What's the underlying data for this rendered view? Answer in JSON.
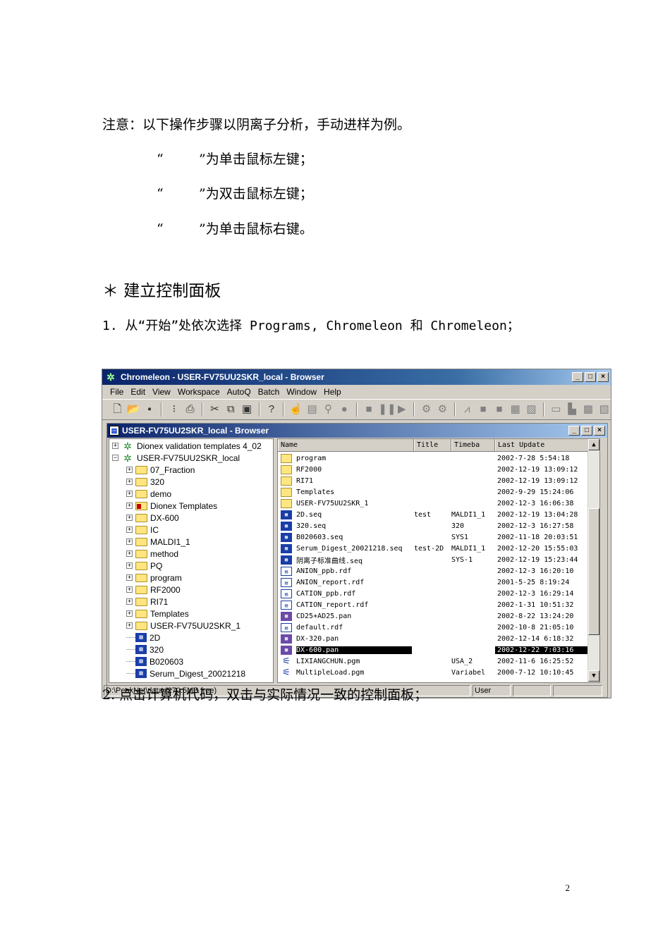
{
  "doc": {
    "note": "注意：以下操作步骤以阴离子分析，手动进样为例。",
    "mouse_lines": [
      {
        "open": "“",
        "close": "”为单击鼠标左键；"
      },
      {
        "open": "“",
        "close": "”为双击鼠标左键；"
      },
      {
        "open": "“",
        "close": "”为单击鼠标右键。"
      }
    ],
    "heading": "＊ 建立控制面板",
    "step1": "1. 从“开始”处依次选择 Programs, Chromeleon 和 Chromeleon；",
    "step2": "2. 点击计算机代码，双击与实际情况一致的控制面板；",
    "page_number": "2"
  },
  "window": {
    "title": "Chromeleon - USER-FV75UU2SKR_local - Browser",
    "menu": [
      "File",
      "Edit",
      "View",
      "Workspace",
      "AutoQ",
      "Batch",
      "Window",
      "Help"
    ],
    "toolbar_icons": [
      "new-icon",
      "open-icon",
      "save-icon",
      "print-icon",
      "cut-icon",
      "copy-icon",
      "paste-icon",
      "help-icon",
      "pointer-icon",
      "stop-icon",
      "pause-icon",
      "play-icon"
    ],
    "child_title": "USER-FV75UU2SKR_local - Browser",
    "tree": [
      {
        "label": "Dionex validation templates 4_02",
        "level": 0,
        "icon": "server-icon",
        "expander": "+"
      },
      {
        "label": "USER-FV75UU2SKR_local",
        "level": 0,
        "icon": "server-icon",
        "expander": "−"
      },
      {
        "label": "07_Fraction",
        "level": 1,
        "icon": "folder-icon",
        "expander": "+"
      },
      {
        "label": "320",
        "level": 1,
        "icon": "folder-icon",
        "expander": "+"
      },
      {
        "label": "demo",
        "level": 1,
        "icon": "folder-icon",
        "expander": "+"
      },
      {
        "label": "Dionex Templates",
        "level": 1,
        "icon": "locked-folder-icon",
        "expander": "+"
      },
      {
        "label": "DX-600",
        "level": 1,
        "icon": "folder-icon",
        "expander": "+"
      },
      {
        "label": "IC",
        "level": 1,
        "icon": "folder-icon",
        "expander": "+"
      },
      {
        "label": "MALDI1_1",
        "level": 1,
        "icon": "folder-icon",
        "expander": "+"
      },
      {
        "label": "method",
        "level": 1,
        "icon": "folder-icon",
        "expander": "+"
      },
      {
        "label": "PQ",
        "level": 1,
        "icon": "folder-icon",
        "expander": "+"
      },
      {
        "label": "program",
        "level": 1,
        "icon": "folder-icon",
        "expander": "+"
      },
      {
        "label": "RF2000",
        "level": 1,
        "icon": "folder-icon",
        "expander": "+"
      },
      {
        "label": "RI71",
        "level": 1,
        "icon": "folder-icon",
        "expander": "+"
      },
      {
        "label": "Templates",
        "level": 1,
        "icon": "folder-icon",
        "expander": "+"
      },
      {
        "label": "USER-FV75UU2SKR_1",
        "level": 1,
        "icon": "folder-icon",
        "expander": "+"
      },
      {
        "label": "2D",
        "level": 1,
        "icon": "sequence-icon",
        "expander": ""
      },
      {
        "label": "320",
        "level": 1,
        "icon": "sequence-icon",
        "expander": ""
      },
      {
        "label": "B020603",
        "level": 1,
        "icon": "sequence-icon",
        "expander": ""
      },
      {
        "label": "Serum_Digest_20021218",
        "level": 1,
        "icon": "sequence-icon",
        "expander": ""
      }
    ],
    "list_headers": [
      "Name",
      "Title",
      "Timeba",
      "Last Update"
    ],
    "files": [
      {
        "name": "program",
        "title": "",
        "timebase": "",
        "date": "2002-7-28 5:54:18",
        "icon": "folder"
      },
      {
        "name": "RF2000",
        "title": "",
        "timebase": "",
        "date": "2002-12-19 13:09:12",
        "icon": "folder"
      },
      {
        "name": "RI71",
        "title": "",
        "timebase": "",
        "date": "2002-12-19 13:09:12",
        "icon": "folder"
      },
      {
        "name": "Templates",
        "title": "",
        "timebase": "",
        "date": "2002-9-29 15:24:06",
        "icon": "folder"
      },
      {
        "name": "USER-FV75UU2SKR_1",
        "title": "",
        "timebase": "",
        "date": "2002-12-3 16:06:38",
        "icon": "folder"
      },
      {
        "name": "2D.seq",
        "title": "test",
        "timebase": "MALDI1_1",
        "date": "2002-12-19 13:04:28",
        "icon": "seq"
      },
      {
        "name": "320.seq",
        "title": "",
        "timebase": "320",
        "date": "2002-12-3 16:27:58",
        "icon": "seq"
      },
      {
        "name": "B020603.seq",
        "title": "",
        "timebase": "SYS1",
        "date": "2002-11-18 20:03:51",
        "icon": "seq"
      },
      {
        "name": "Serum_Digest_20021218.seq",
        "title": "test-2D",
        "timebase": "MALDI1_1",
        "date": "2002-12-20 15:55:03",
        "icon": "seq"
      },
      {
        "name": "阴离子标准曲线.seq",
        "title": "",
        "timebase": "SYS-1",
        "date": "2002-12-19 15:23:44",
        "icon": "seq"
      },
      {
        "name": "ANION_ppb.rdf",
        "title": "",
        "timebase": "",
        "date": "2002-12-3 16:20:10",
        "icon": "rdf"
      },
      {
        "name": "ANION_report.rdf",
        "title": "",
        "timebase": "",
        "date": "2001-5-25 8:19:24",
        "icon": "rdf"
      },
      {
        "name": "CATION_ppb.rdf",
        "title": "",
        "timebase": "",
        "date": "2002-12-3 16:29:14",
        "icon": "rdf"
      },
      {
        "name": "CATION_report.rdf",
        "title": "",
        "timebase": "",
        "date": "2002-1-31 10:51:32",
        "icon": "rdf"
      },
      {
        "name": "CD25+AD25.pan",
        "title": "",
        "timebase": "",
        "date": "2002-8-22 13:24:20",
        "icon": "pan"
      },
      {
        "name": "default.rdf",
        "title": "",
        "timebase": "",
        "date": "2002-10-8 21:05:10",
        "icon": "rdf"
      },
      {
        "name": "DX-320.pan",
        "title": "",
        "timebase": "",
        "date": "2002-12-14 6:18:32",
        "icon": "pan"
      },
      {
        "name": "DX-600.pan",
        "title": "",
        "timebase": "",
        "date": "2002-12-22 7:03:16",
        "icon": "pan",
        "selected": true
      },
      {
        "name": "LIXIANGCHUN.pgm",
        "title": "",
        "timebase": "USA_2",
        "date": "2002-11-6 16:25:52",
        "icon": "pgm"
      },
      {
        "name": "MultipleLoad.pgm",
        "title": "",
        "timebase": "Variabel",
        "date": "2000-7-12 10:10:45",
        "icon": "pgm"
      }
    ],
    "status_path": "D:\\PeakNet\\data (270.5MB free)",
    "status_user": "User"
  }
}
